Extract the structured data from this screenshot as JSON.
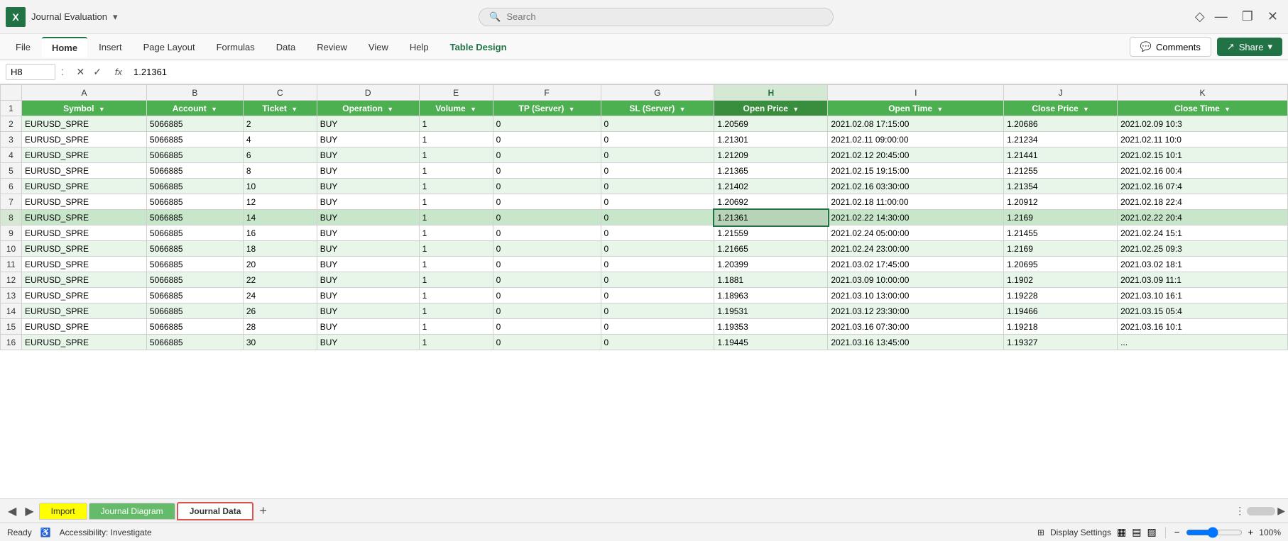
{
  "titleBar": {
    "appLogo": "X",
    "appTitle": "Journal Evaluation",
    "dropdownArrow": "▾",
    "searchPlaceholder": "Search",
    "minimizeBtn": "—",
    "restoreBtn": "❐",
    "closeBtn": "✕",
    "diamondIcon": "◇"
  },
  "ribbon": {
    "tabs": [
      {
        "label": "File",
        "active": false
      },
      {
        "label": "Home",
        "active": true
      },
      {
        "label": "Insert",
        "active": false
      },
      {
        "label": "Page Layout",
        "active": false
      },
      {
        "label": "Formulas",
        "active": false
      },
      {
        "label": "Data",
        "active": false
      },
      {
        "label": "Review",
        "active": false
      },
      {
        "label": "View",
        "active": false
      },
      {
        "label": "Help",
        "active": false
      },
      {
        "label": "Table Design",
        "active": false,
        "special": "table-design"
      }
    ],
    "commentsBtn": "Comments",
    "shareBtn": "Share"
  },
  "formulaBar": {
    "cellRef": "H8",
    "cancelBtn": "✕",
    "confirmBtn": "✓",
    "fxLabel": "fx",
    "formula": "1.21361"
  },
  "columns": [
    {
      "id": "A",
      "label": "Symbol",
      "cls": "col-a"
    },
    {
      "id": "B",
      "label": "Account",
      "cls": "col-b"
    },
    {
      "id": "C",
      "label": "Ticket",
      "cls": "col-c"
    },
    {
      "id": "D",
      "label": "Operation",
      "cls": "col-d"
    },
    {
      "id": "E",
      "label": "Volume",
      "cls": "col-e"
    },
    {
      "id": "F",
      "label": "TP (Server)",
      "cls": "col-f"
    },
    {
      "id": "G",
      "label": "SL (Server)",
      "cls": "col-g"
    },
    {
      "id": "H",
      "label": "Open Price",
      "cls": "col-h"
    },
    {
      "id": "I",
      "label": "Open Time",
      "cls": "col-i"
    },
    {
      "id": "J",
      "label": "Close Price",
      "cls": "col-j"
    },
    {
      "id": "K",
      "label": "Close Time",
      "cls": "col-k"
    }
  ],
  "rows": [
    {
      "num": 2,
      "A": "EURUSD_SPRE",
      "B": "5066885",
      "C": "2",
      "D": "BUY",
      "E": "1",
      "F": "0",
      "G": "0",
      "H": "1.20569",
      "I": "2021.02.08 17:15:00",
      "J": "1.20686",
      "K": "2021.02.09 10:3"
    },
    {
      "num": 3,
      "A": "EURUSD_SPRE",
      "B": "5066885",
      "C": "4",
      "D": "BUY",
      "E": "1",
      "F": "0",
      "G": "0",
      "H": "1.21301",
      "I": "2021.02.11 09:00:00",
      "J": "1.21234",
      "K": "2021.02.11 10:0"
    },
    {
      "num": 4,
      "A": "EURUSD_SPRE",
      "B": "5066885",
      "C": "6",
      "D": "BUY",
      "E": "1",
      "F": "0",
      "G": "0",
      "H": "1.21209",
      "I": "2021.02.12 20:45:00",
      "J": "1.21441",
      "K": "2021.02.15 10:1"
    },
    {
      "num": 5,
      "A": "EURUSD_SPRE",
      "B": "5066885",
      "C": "8",
      "D": "BUY",
      "E": "1",
      "F": "0",
      "G": "0",
      "H": "1.21365",
      "I": "2021.02.15 19:15:00",
      "J": "1.21255",
      "K": "2021.02.16 00:4"
    },
    {
      "num": 6,
      "A": "EURUSD_SPRE",
      "B": "5066885",
      "C": "10",
      "D": "BUY",
      "E": "1",
      "F": "0",
      "G": "0",
      "H": "1.21402",
      "I": "2021.02.16 03:30:00",
      "J": "1.21354",
      "K": "2021.02.16 07:4"
    },
    {
      "num": 7,
      "A": "EURUSD_SPRE",
      "B": "5066885",
      "C": "12",
      "D": "BUY",
      "E": "1",
      "F": "0",
      "G": "0",
      "H": "1.20692",
      "I": "2021.02.18 11:00:00",
      "J": "1.20912",
      "K": "2021.02.18 22:4"
    },
    {
      "num": 8,
      "A": "EURUSD_SPRE",
      "B": "5066885",
      "C": "14",
      "D": "BUY",
      "E": "1",
      "F": "0",
      "G": "0",
      "H": "1.21361",
      "I": "2021.02.22 14:30:00",
      "J": "1.2169",
      "K": "2021.02.22 20:4",
      "active": true
    },
    {
      "num": 9,
      "A": "EURUSD_SPRE",
      "B": "5066885",
      "C": "16",
      "D": "BUY",
      "E": "1",
      "F": "0",
      "G": "0",
      "H": "1.21559",
      "I": "2021.02.24 05:00:00",
      "J": "1.21455",
      "K": "2021.02.24 15:1"
    },
    {
      "num": 10,
      "A": "EURUSD_SPRE",
      "B": "5066885",
      "C": "18",
      "D": "BUY",
      "E": "1",
      "F": "0",
      "G": "0",
      "H": "1.21665",
      "I": "2021.02.24 23:00:00",
      "J": "1.2169",
      "K": "2021.02.25 09:3"
    },
    {
      "num": 11,
      "A": "EURUSD_SPRE",
      "B": "5066885",
      "C": "20",
      "D": "BUY",
      "E": "1",
      "F": "0",
      "G": "0",
      "H": "1.20399",
      "I": "2021.03.02 17:45:00",
      "J": "1.20695",
      "K": "2021.03.02 18:1"
    },
    {
      "num": 12,
      "A": "EURUSD_SPRE",
      "B": "5066885",
      "C": "22",
      "D": "BUY",
      "E": "1",
      "F": "0",
      "G": "0",
      "H": "1.1881",
      "I": "2021.03.09 10:00:00",
      "J": "1.1902",
      "K": "2021.03.09 11:1"
    },
    {
      "num": 13,
      "A": "EURUSD_SPRE",
      "B": "5066885",
      "C": "24",
      "D": "BUY",
      "E": "1",
      "F": "0",
      "G": "0",
      "H": "1.18963",
      "I": "2021.03.10 13:00:00",
      "J": "1.19228",
      "K": "2021.03.10 16:1"
    },
    {
      "num": 14,
      "A": "EURUSD_SPRE",
      "B": "5066885",
      "C": "26",
      "D": "BUY",
      "E": "1",
      "F": "0",
      "G": "0",
      "H": "1.19531",
      "I": "2021.03.12 23:30:00",
      "J": "1.19466",
      "K": "2021.03.15 05:4"
    },
    {
      "num": 15,
      "A": "EURUSD_SPRE",
      "B": "5066885",
      "C": "28",
      "D": "BUY",
      "E": "1",
      "F": "0",
      "G": "0",
      "H": "1.19353",
      "I": "2021.03.16 07:30:00",
      "J": "1.19218",
      "K": "2021.03.16 10:1"
    },
    {
      "num": 16,
      "A": "EURUSD_SPRE",
      "B": "5066885",
      "C": "30",
      "D": "BUY",
      "E": "1",
      "F": "0",
      "G": "0",
      "H": "1.19445",
      "I": "2021.03.16 13:45:00",
      "J": "1.19327",
      "K": "..."
    }
  ],
  "sheetTabs": [
    {
      "label": "Import",
      "cls": "import"
    },
    {
      "label": "Journal Diagram",
      "cls": "journal-diagram"
    },
    {
      "label": "Journal Data",
      "cls": "journal-data",
      "active": true
    }
  ],
  "statusBar": {
    "ready": "Ready",
    "accessibility": "Accessibility: Investigate",
    "displaySettings": "Display Settings",
    "viewNormal": "▦",
    "viewLayout": "▤",
    "viewPage": "▨",
    "zoomOut": "−",
    "zoomIn": "+",
    "zoomLevel": "100%"
  },
  "colors": {
    "headerGreen": "#4caf50",
    "headerDarkGreen": "#388e3c",
    "rowEven": "#e8f5e9",
    "activeRowBg": "#c8dfc8",
    "selectedCellBg": "#b8d4b8",
    "tabYellow": "#ffff00",
    "tabGreen": "#66bb6a",
    "tableDesignColor": "#217346",
    "activeTabBorderRed": "#d9534f"
  }
}
